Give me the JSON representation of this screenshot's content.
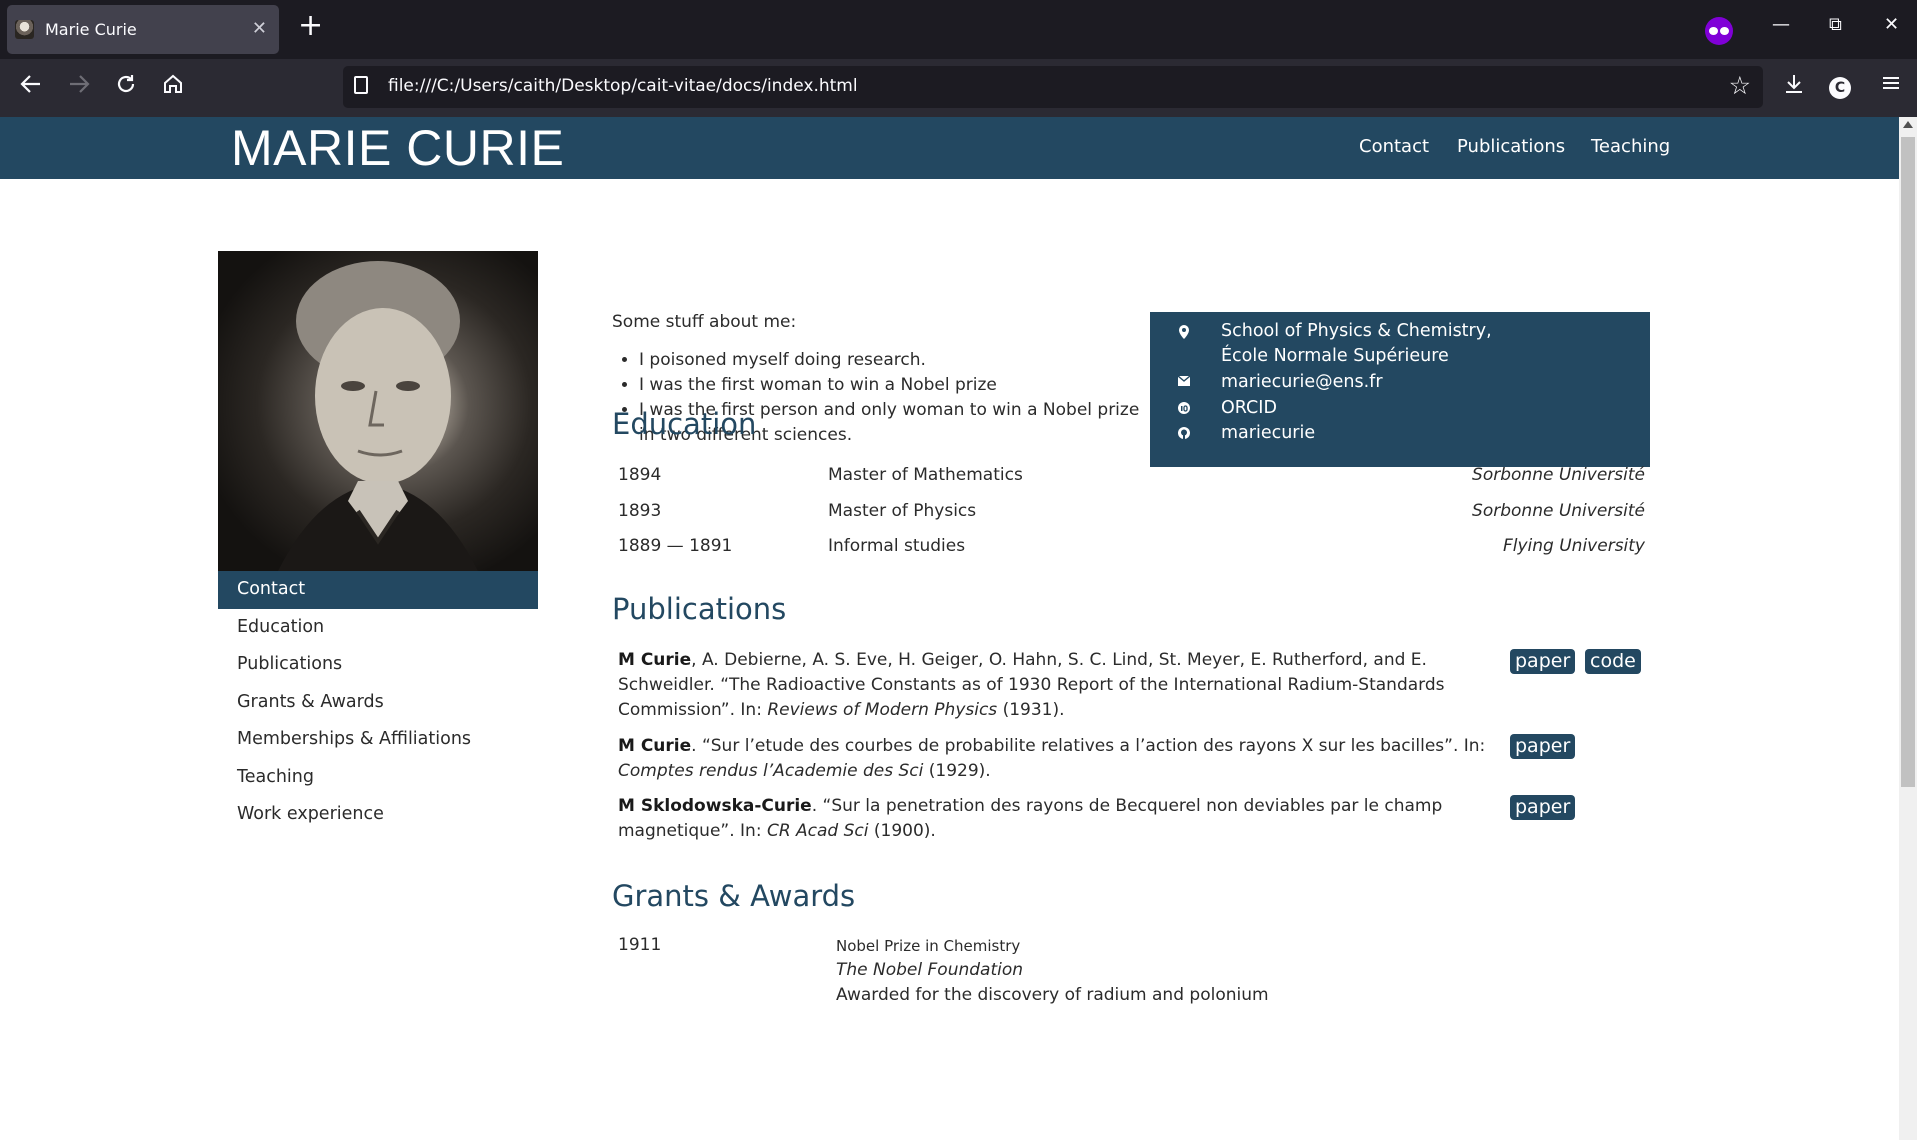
{
  "browser": {
    "tab_title": "Marie Curie",
    "tab_close": "✕",
    "new_tab": "+",
    "url": "file:///C:/Users/caith/Desktop/cait-vitae/docs/index.html",
    "account_initial": "C",
    "nav_icons": {
      "back": "arrow-left-icon",
      "forward": "arrow-right-icon",
      "reload": "reload-icon",
      "home": "home-icon"
    },
    "window_buttons": {
      "minimize": "—",
      "restore": "⧉",
      "close": "✕"
    }
  },
  "header": {
    "title": "MARIE CURIE",
    "nav": [
      "Contact",
      "Publications",
      "Teaching"
    ]
  },
  "sidebar": {
    "items": [
      {
        "label": "Contact",
        "active": true
      },
      {
        "label": "Education",
        "active": false
      },
      {
        "label": "Publications",
        "active": false
      },
      {
        "label": "Grants & Awards",
        "active": false
      },
      {
        "label": "Memberships & Affiliations",
        "active": false
      },
      {
        "label": "Teaching",
        "active": false
      },
      {
        "label": "Work experience",
        "active": false
      }
    ]
  },
  "about": {
    "intro": "Some stuff about me:",
    "items": [
      "I poisoned myself doing research.",
      "I was the first woman to win a Nobel prize",
      "I was the first person and only woman to win a Nobel prize in two different sciences."
    ]
  },
  "contact": {
    "address_line1": "School of Physics & Chemistry,",
    "address_line2": "École Normale Supérieure",
    "email": "mariecurie@ens.fr",
    "orcid": "ORCID",
    "github": "mariecurie",
    "accent": "#234861"
  },
  "education": {
    "title": "Education",
    "rows": [
      {
        "year": "1894",
        "degree": "Master of Mathematics",
        "institution": "Sorbonne Université"
      },
      {
        "year": "1893",
        "degree": "Master of Physics",
        "institution": "Sorbonne Université"
      },
      {
        "year": "1889 — 1891",
        "degree": "Informal studies",
        "institution": "Flying University"
      }
    ]
  },
  "publications": {
    "title": "Publications",
    "items": [
      {
        "author_bold": "M Curie",
        "rest": ", A. Debierne, A. S. Eve, H. Geiger, O. Hahn, S. C. Lind, St. Meyer, E. Rutherford, and E. Schweidler. “The Radioactive Constants as of 1930 Report of the International Radium-Standards Commission”. In: ",
        "venue": "Reviews of Modern Physics",
        "year": " (1931).",
        "badges": [
          "paper",
          "code"
        ]
      },
      {
        "author_bold": "M Curie",
        "rest": ". “Sur l’etude des courbes de probabilite relatives a l’action des rayons X sur les bacilles”. In: ",
        "venue": "Comptes rendus l’Academie des Sci",
        "year": " (1929).",
        "badges": [
          "paper"
        ]
      },
      {
        "author_bold": "M Sklodowska-Curie",
        "rest": ". “Sur la penetration des rayons de Becquerel non deviables par le champ magnetique”. In: ",
        "venue": "CR Acad Sci",
        "year": " (1900).",
        "badges": [
          "paper"
        ]
      }
    ]
  },
  "grants": {
    "title": "Grants & Awards",
    "items": [
      {
        "year": "1911",
        "title": "Nobel Prize in Chemistry",
        "org": "The Nobel Foundation",
        "description": "Awarded for the discovery of radium and polonium"
      }
    ]
  }
}
